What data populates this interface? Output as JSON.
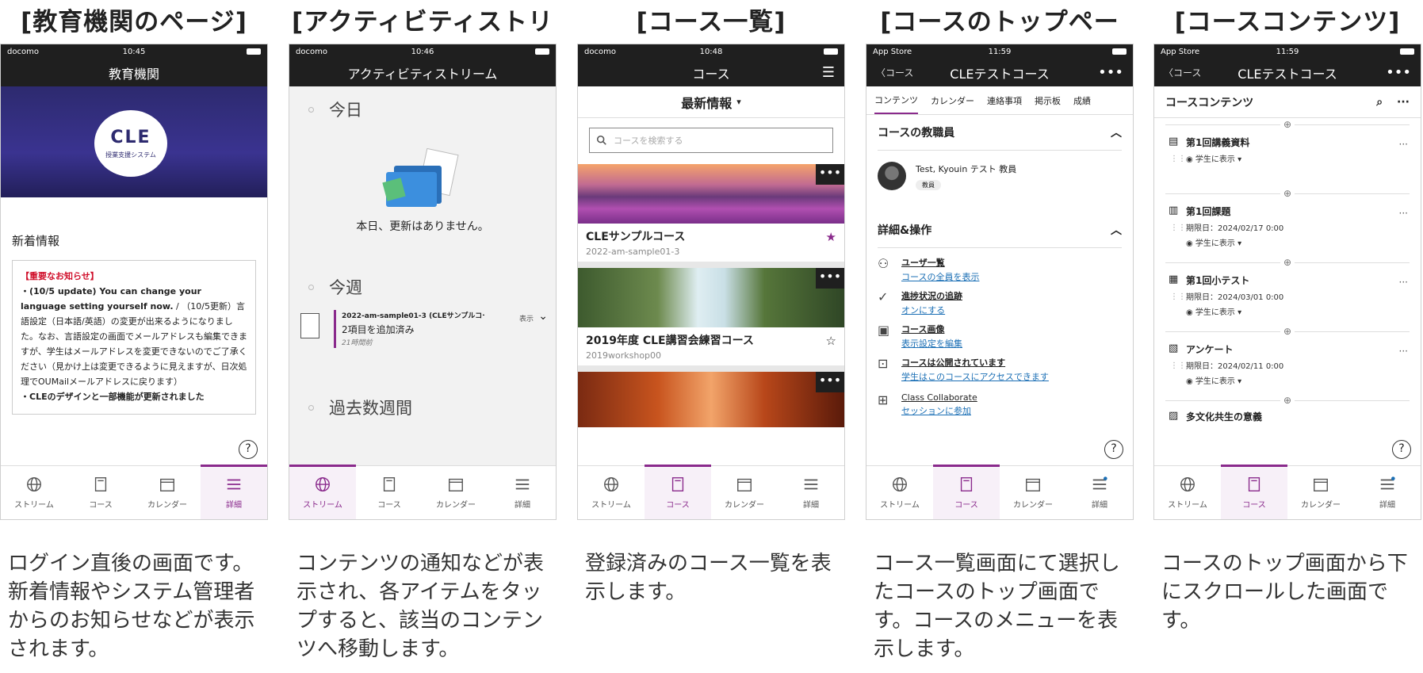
{
  "columns": [
    {
      "title": "[教育機関のページ]",
      "caption": "ログイン直後の画面です。新着情報やシステム管理者からのお知らせなどが表示されます。"
    },
    {
      "title": "[アクティビティストリーム]",
      "caption": "コンテンツの通知などが表示され、各アイテムをタップすると、該当のコンテンツへ移動します。"
    },
    {
      "title": "[コース一覧]",
      "caption": "登録済みのコース一覧を表示します。"
    },
    {
      "title": "[コースのトップページ]",
      "caption": "コース一覧画面にて選択したコースのトップ画面です。コースのメニューを表示します。"
    },
    {
      "title": "[コースコンテンツ]",
      "caption": "コースのトップ画面から下にスクロールした画面です。"
    }
  ],
  "tabs": {
    "stream": "ストリーム",
    "course": "コース",
    "calendar": "カレンダー",
    "detail": "詳細"
  },
  "screen1": {
    "carrier": "docomo",
    "time": "10:45",
    "nav_title": "教育機関",
    "logo": "CLE",
    "logo_sub": "授業支援システム",
    "news_heading": "新着情報",
    "news_important": "【重要なお知らせ】",
    "news_bold": "・(10/5 update) You can change your language setting yourself now.",
    "news_text": " / （10/5更新）言語設定（日本語/英語）の変更が出来るようになりました。なお、言語設定の画面でメールアドレスも編集できますが、学生はメールアドレスを変更できないのでご了承ください（見かけ上は変更できるように見えますが、日次処理でOUMailメールアドレスに戻ります）",
    "news_more": "・CLEのデザインと一部機能が更新されました"
  },
  "screen2": {
    "carrier": "docomo",
    "time": "10:46",
    "nav_title": "アクティビティストリーム",
    "today": "今日",
    "today_empty": "本日、更新はありません。",
    "week": "今週",
    "item_course": "2022-am-sample01-3 (CLEサンプルコー…",
    "item_text": "2項目を追加済み",
    "item_time": "21時間前",
    "item_show": "表示",
    "past": "過去数週間"
  },
  "screen3": {
    "carrier": "docomo",
    "time": "10:48",
    "nav_title": "コース",
    "filter": "最新情報",
    "search_placeholder": "コースを検索する",
    "courses": [
      {
        "title": "CLEサンプルコース",
        "id": "2022-am-sample01-3"
      },
      {
        "title": "2019年度 CLE講習会練習コース",
        "id": "2019workshop00"
      }
    ]
  },
  "screen4": {
    "carrier": "App Store",
    "time": "11:59",
    "back": "コース",
    "nav_title": "CLEテストコース",
    "tabs": [
      "コンテンツ",
      "カレンダー",
      "連絡事項",
      "掲示板",
      "成績"
    ],
    "instructors_h": "コースの教職員",
    "instructor_name": "Test, Kyouin テスト 教員",
    "instructor_role": "教員",
    "ops_h": "詳細&操作",
    "ops": [
      {
        "title": "ユーザ一覧",
        "link": "コースの全員を表示"
      },
      {
        "title": "進捗状況の追跡",
        "link": "オンにする"
      },
      {
        "title": "コース画像",
        "link": "表示設定を編集"
      },
      {
        "title": "コースは公開されています",
        "link": "学生はこのコースにアクセスできます"
      },
      {
        "title": "Class Collaborate",
        "link": "セッションに参加"
      }
    ]
  },
  "screen5": {
    "carrier": "App Store",
    "time": "11:59",
    "back": "コース",
    "nav_title": "CLEテストコース",
    "heading": "コースコンテンツ",
    "items": [
      {
        "title": "第1回講義資料",
        "due": "",
        "vis": "学生に表示"
      },
      {
        "title": "第1回課題",
        "due": "期限日：2024/02/17 0:00",
        "vis": "学生に表示"
      },
      {
        "title": "第1回小テスト",
        "due": "期限日：2024/03/01 0:00",
        "vis": "学生に表示"
      },
      {
        "title": "アンケート",
        "due": "期限日：2024/02/11 0:00",
        "vis": "学生に表示"
      }
    ],
    "last_item": "多文化共生の意義"
  },
  "colors": {
    "accent": "#8a2a8c",
    "navbar": "#1f1f1f",
    "link": "#1b6fb5"
  }
}
